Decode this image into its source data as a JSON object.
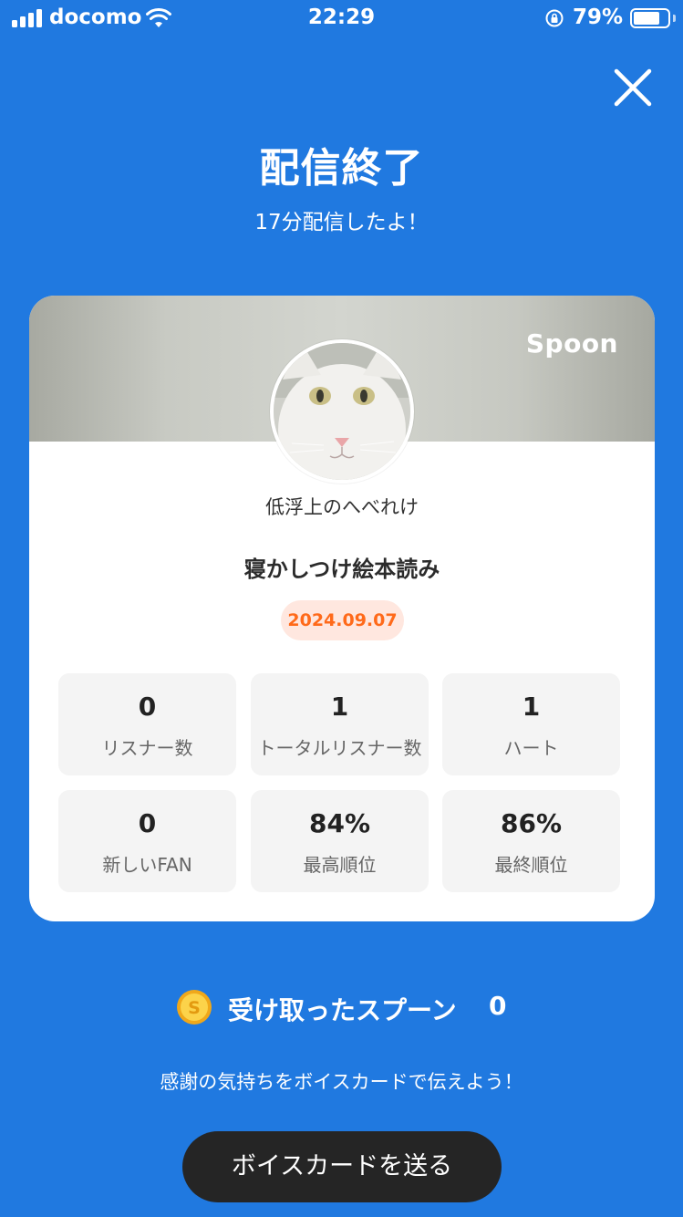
{
  "status_bar": {
    "carrier": "docomo",
    "time": "22:29",
    "battery_percent": "79%",
    "battery_level": 0.79
  },
  "header": {
    "title": "配信終了",
    "subtitle": "17分配信したよ！"
  },
  "card": {
    "brand": "Spoon",
    "dj_name": "低浮上のへべれけ",
    "live_title": "寝かしつけ絵本読み",
    "date": "2024.09.07",
    "stats": [
      {
        "value": "0",
        "label": "リスナー数"
      },
      {
        "value": "1",
        "label": "トータルリスナー数"
      },
      {
        "value": "1",
        "label": "ハート"
      },
      {
        "value": "0",
        "label": "新しいFAN"
      },
      {
        "value": "84%",
        "label": "最高順位"
      },
      {
        "value": "86%",
        "label": "最終順位"
      }
    ]
  },
  "spoons": {
    "label": "受け取ったスプーン",
    "count": "0"
  },
  "thanks_text": "感謝の気持ちをボイスカードで伝えよう！",
  "voicecard_button": "ボイスカードを送る",
  "colors": {
    "background": "#2079e0",
    "date_text": "#ff6a1a",
    "date_badge": "#ffe7df",
    "button": "#252525"
  }
}
